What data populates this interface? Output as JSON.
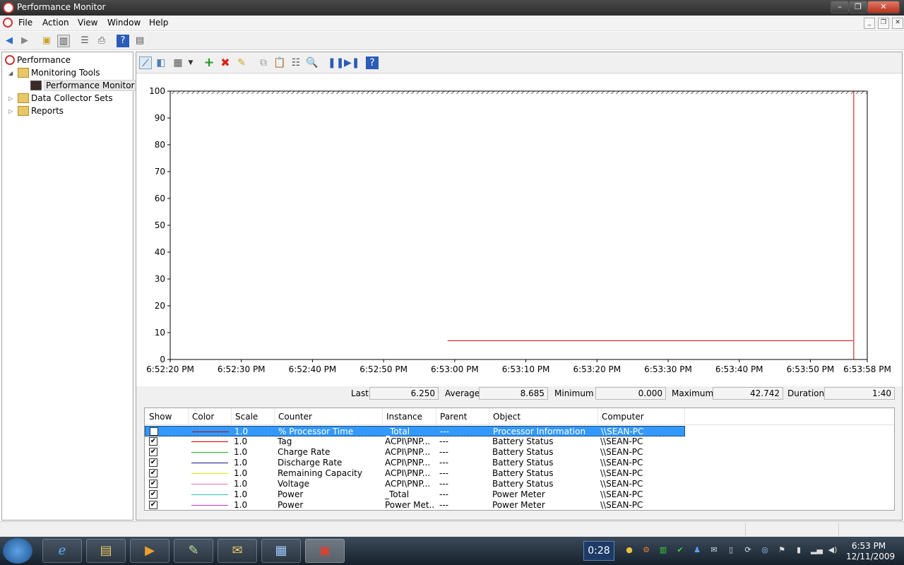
{
  "window": {
    "title": "Performance Monitor"
  },
  "menu": [
    "File",
    "Action",
    "View",
    "Window",
    "Help"
  ],
  "tree": {
    "root": "Performance",
    "monitoring_tools": "Monitoring Tools",
    "performance_monitor": "Performance Monitor",
    "data_collector_sets": "Data Collector Sets",
    "reports": "Reports"
  },
  "chart_data": {
    "type": "line",
    "ylim": [
      0,
      100
    ],
    "yticks": [
      "100",
      "90",
      "80",
      "70",
      "60",
      "50",
      "40",
      "30",
      "20",
      "10",
      "0"
    ],
    "xticks": [
      "6:52:20 PM",
      "6:52:30 PM",
      "6:52:40 PM",
      "6:52:50 PM",
      "6:53:00 PM",
      "6:53:10 PM",
      "6:53:20 PM",
      "6:53:30 PM",
      "6:53:40 PM",
      "6:53:50 PM",
      "6:53:58 PM"
    ],
    "series": [
      {
        "name": "% Processor Time",
        "color": "#cc0000",
        "x": [
          "6:52:59 PM",
          "6:53:56 PM"
        ],
        "values": [
          7,
          7
        ]
      }
    ]
  },
  "stats": {
    "last_label": "Last",
    "last": "6.250",
    "average_label": "Average",
    "average": "8.685",
    "minimum_label": "Minimum",
    "minimum": "0.000",
    "maximum_label": "Maximum",
    "maximum": "42.742",
    "duration_label": "Duration",
    "duration": "1:40"
  },
  "legend": {
    "headers": {
      "show": "Show",
      "color": "Color",
      "scale": "Scale",
      "counter": "Counter",
      "instance": "Instance",
      "parent": "Parent",
      "object": "Object",
      "computer": "Computer"
    },
    "rows": [
      {
        "show": false,
        "color": "#cc0000",
        "scale": "1.0",
        "counter": "% Processor Time",
        "instance": "_Total",
        "parent": "---",
        "object": "Processor Information",
        "computer": "\\\\SEAN-PC",
        "selected": true
      },
      {
        "show": true,
        "color": "#cc0000",
        "scale": "1.0",
        "counter": "Tag",
        "instance": "ACPI\\PNP...",
        "parent": "---",
        "object": "Battery Status",
        "computer": "\\\\SEAN-PC"
      },
      {
        "show": true,
        "color": "#22aa22",
        "scale": "1.0",
        "counter": "Charge Rate",
        "instance": "ACPI\\PNP...",
        "parent": "---",
        "object": "Battery Status",
        "computer": "\\\\SEAN-PC"
      },
      {
        "show": true,
        "color": "#1a1a88",
        "scale": "1.0",
        "counter": "Discharge Rate",
        "instance": "ACPI\\PNP...",
        "parent": "---",
        "object": "Battery Status",
        "computer": "\\\\SEAN-PC"
      },
      {
        "show": true,
        "color": "#e6e600",
        "scale": "1.0",
        "counter": "Remaining Capacity",
        "instance": "ACPI\\PNP...",
        "parent": "---",
        "object": "Battery Status",
        "computer": "\\\\SEAN-PC"
      },
      {
        "show": true,
        "color": "#e07aa8",
        "scale": "1.0",
        "counter": "Voltage",
        "instance": "ACPI\\PNP...",
        "parent": "---",
        "object": "Battery Status",
        "computer": "\\\\SEAN-PC"
      },
      {
        "show": true,
        "color": "#33bbbb",
        "scale": "1.0",
        "counter": "Power",
        "instance": "_Total",
        "parent": "---",
        "object": "Power Meter",
        "computer": "\\\\SEAN-PC"
      },
      {
        "show": true,
        "color": "#cc33cc",
        "scale": "1.0",
        "counter": "Power",
        "instance": "Power Met...",
        "parent": "---",
        "object": "Power Meter",
        "computer": "\\\\SEAN-PC"
      }
    ]
  },
  "taskbar": {
    "timer": "0:28",
    "time": "6:53 PM",
    "date": "12/11/2009"
  }
}
